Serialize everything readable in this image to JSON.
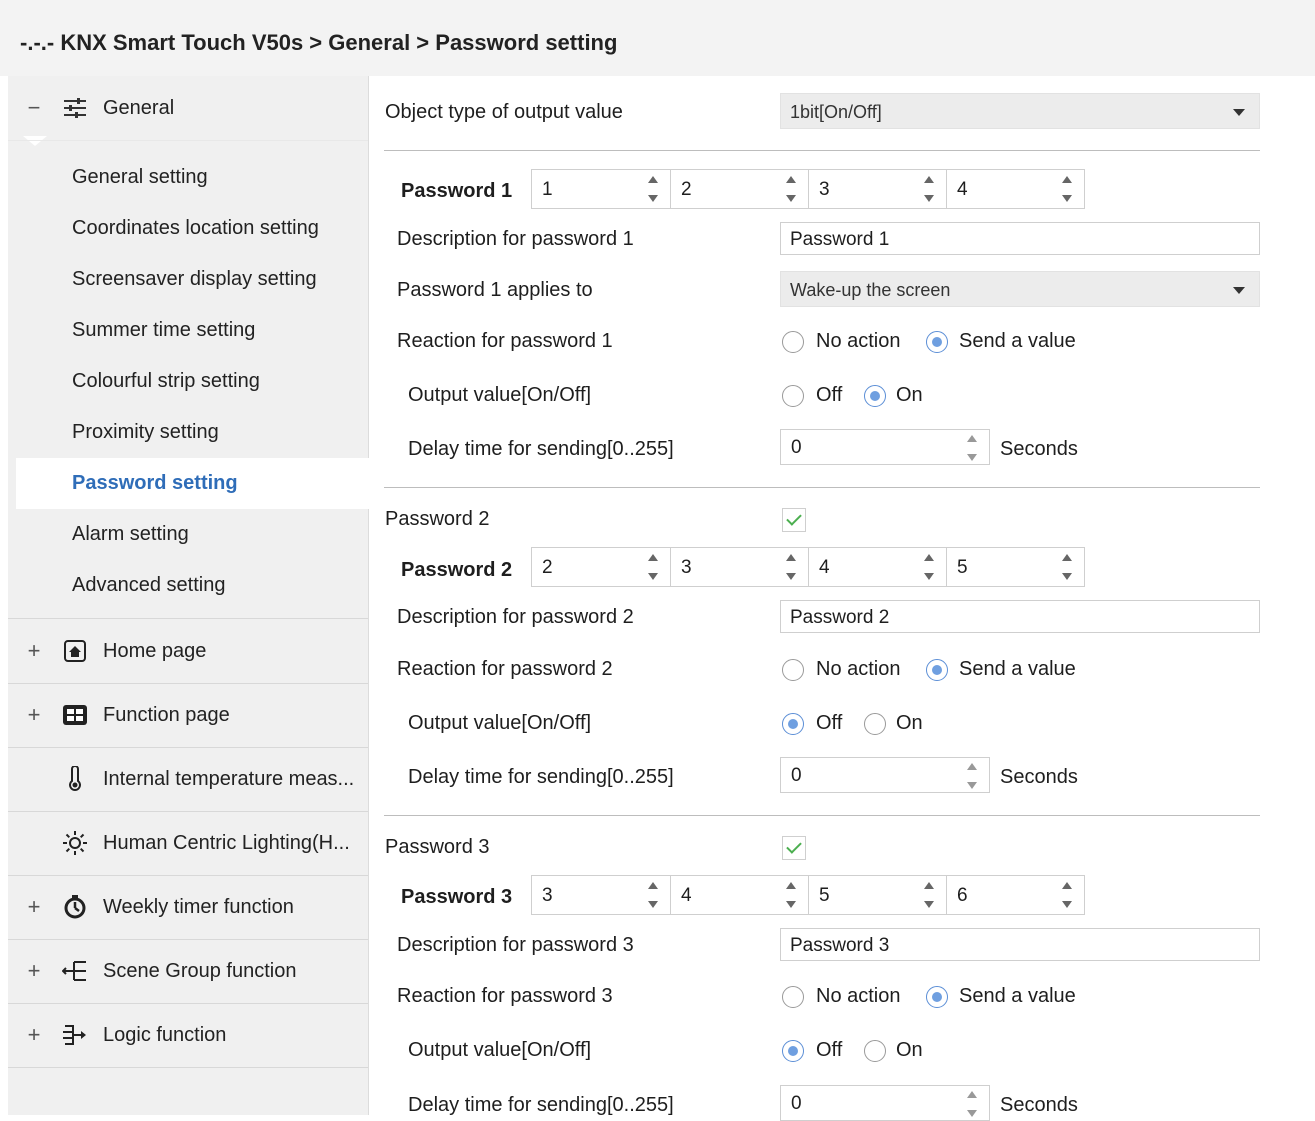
{
  "title": "-.-.- KNX Smart Touch V50s > General > Password setting",
  "sidebar": {
    "general": {
      "expander": "−",
      "label": "General"
    },
    "sub_items": [
      "General setting",
      "Coordinates location setting",
      "Screensaver display setting",
      "Summer time setting",
      "Colourful strip setting",
      "Proximity setting",
      "Password setting",
      "Alarm setting",
      "Advanced setting"
    ],
    "selected": "Password setting",
    "groups": [
      {
        "expander": "+",
        "label": "Home page",
        "icon": "home-icon"
      },
      {
        "expander": "+",
        "label": "Function page",
        "icon": "grid-icon"
      },
      {
        "expander": "",
        "label": "Internal temperature meas...",
        "icon": "thermometer-icon"
      },
      {
        "expander": "",
        "label": "Human Centric Lighting(H...",
        "icon": "sun-icon"
      },
      {
        "expander": "+",
        "label": "Weekly timer function",
        "icon": "timer-icon"
      },
      {
        "expander": "+",
        "label": "Scene Group function",
        "icon": "scene-group-icon"
      },
      {
        "expander": "+",
        "label": "Logic function",
        "icon": "logic-icon"
      }
    ]
  },
  "main": {
    "object_type": {
      "label": "Object type of output value",
      "value": "1bit[On/Off]"
    },
    "passwords": [
      {
        "header_label": "",
        "enabled": null,
        "code_label": "Password 1",
        "digits": [
          "1",
          "2",
          "3",
          "4"
        ],
        "description_label": "Description for password 1",
        "description_value": "Password 1",
        "applies_label": "Password 1 applies to",
        "applies_value": "Wake-up the screen",
        "reaction_label": "Reaction for password 1",
        "reaction_options": [
          "No action",
          "Send a value"
        ],
        "reaction_selected": "Send a value",
        "output_label": "Output value[On/Off]",
        "output_options": [
          "Off",
          "On"
        ],
        "output_selected": "On",
        "delay_label": "Delay time for sending[0..255]",
        "delay_value": "0",
        "delay_unit": "Seconds"
      },
      {
        "header_label": "Password 2",
        "enabled": true,
        "code_label": "Password 2",
        "digits": [
          "2",
          "3",
          "4",
          "5"
        ],
        "description_label": "Description for password 2",
        "description_value": "Password 2",
        "reaction_label": "Reaction for password 2",
        "reaction_options": [
          "No action",
          "Send a value"
        ],
        "reaction_selected": "Send a value",
        "output_label": "Output value[On/Off]",
        "output_options": [
          "Off",
          "On"
        ],
        "output_selected": "Off",
        "delay_label": "Delay time for sending[0..255]",
        "delay_value": "0",
        "delay_unit": "Seconds"
      },
      {
        "header_label": "Password 3",
        "enabled": true,
        "code_label": "Password 3",
        "digits": [
          "3",
          "4",
          "5",
          "6"
        ],
        "description_label": "Description for password 3",
        "description_value": "Password 3",
        "reaction_label": "Reaction for password 3",
        "reaction_options": [
          "No action",
          "Send a value"
        ],
        "reaction_selected": "Send a value",
        "output_label": "Output value[On/Off]",
        "output_options": [
          "Off",
          "On"
        ],
        "output_selected": "Off",
        "delay_label": "Delay time for sending[0..255]",
        "delay_value": "0",
        "delay_unit": "Seconds"
      }
    ]
  }
}
